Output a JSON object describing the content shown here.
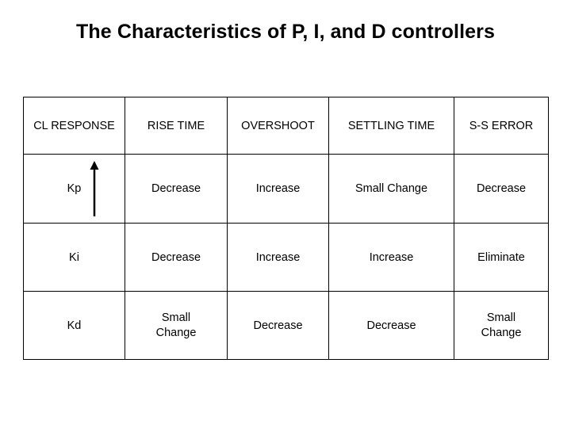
{
  "slide": {
    "title": "The Characteristics of P, I, and D controllers"
  },
  "table": {
    "headers": [
      "CL RESPONSE",
      "RISE TIME",
      "OVERSHOOT",
      "SETTLING TIME",
      "S-S ERROR"
    ],
    "rows": [
      {
        "label": "Kp",
        "has_arrow": true,
        "arrow_icon": "up-arrow-icon",
        "cells": [
          "Decrease",
          "Increase",
          "Small Change",
          "Decrease"
        ]
      },
      {
        "label": "Ki",
        "has_arrow": false,
        "cells": [
          "Decrease",
          "Increase",
          "Increase",
          "Eliminate"
        ]
      },
      {
        "label": "Kd",
        "has_arrow": false,
        "cells": [
          "Small Change",
          "Decrease",
          "Decrease",
          "Small Change"
        ]
      }
    ]
  },
  "colors": {
    "border": "#000000",
    "text": "#000000",
    "background": "#ffffff"
  }
}
